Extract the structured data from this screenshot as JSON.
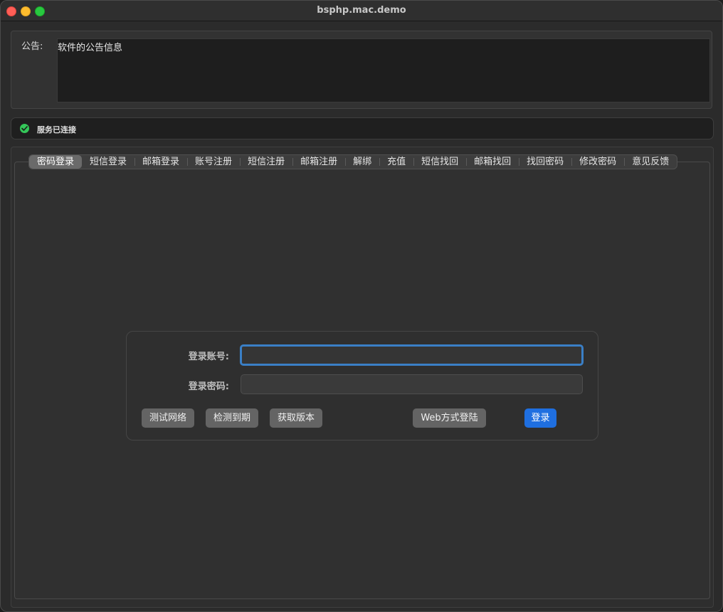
{
  "window": {
    "title": "bsphp.mac.demo"
  },
  "notice": {
    "label": "公告:",
    "text": "软件的公告信息"
  },
  "status": {
    "text": "服务已连接",
    "color": "#34c759"
  },
  "tabs": [
    {
      "label": "密码登录",
      "active": true
    },
    {
      "label": "短信登录"
    },
    {
      "label": "邮箱登录"
    },
    {
      "label": "账号注册"
    },
    {
      "label": "短信注册"
    },
    {
      "label": "邮箱注册"
    },
    {
      "label": "解绑"
    },
    {
      "label": "充值"
    },
    {
      "label": "短信找回"
    },
    {
      "label": "邮箱找回"
    },
    {
      "label": "找回密码"
    },
    {
      "label": "修改密码"
    },
    {
      "label": "意见反馈"
    }
  ],
  "login": {
    "account_label": "登录账号:",
    "account_value": "",
    "password_label": "登录密码:",
    "password_value": "",
    "buttons": {
      "test_network": "测试网络",
      "check_expiry": "检测到期",
      "get_version": "获取版本",
      "web_login": "Web方式登陆",
      "login": "登录"
    }
  },
  "colors": {
    "accent": "#1f6fe0",
    "focus_ring": "#3a7fc6"
  }
}
